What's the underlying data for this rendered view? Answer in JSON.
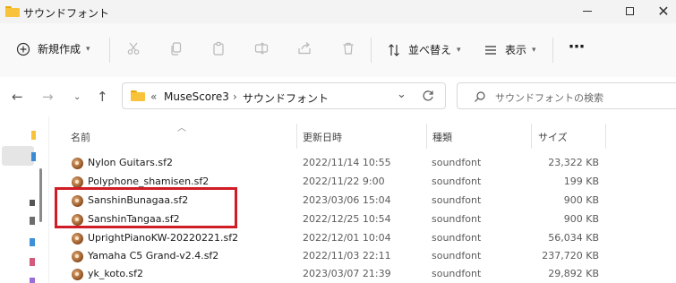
{
  "window": {
    "title": "サウンドフォント"
  },
  "commands": {
    "new_label": "新規作成",
    "sort_label": "並べ替え",
    "view_label": "表示",
    "more_label": "⋯"
  },
  "address": {
    "overflow": "«",
    "crumbs": [
      "MuseScore3",
      "サウンドフォント"
    ],
    "separator": "›"
  },
  "search": {
    "placeholder": "サウンドフォントの検索"
  },
  "columns": {
    "name": "名前",
    "modified": "更新日時",
    "type": "種類",
    "size": "サイズ"
  },
  "files": [
    {
      "name": "Nylon Guitars.sf2",
      "modified": "2022/11/14 10:55",
      "type": "soundfont",
      "size": "23,322 KB"
    },
    {
      "name": "Polyphone_shamisen.sf2",
      "modified": "2022/11/22 9:00",
      "type": "soundfont",
      "size": "199 KB"
    },
    {
      "name": "SanshinBunagaa.sf2",
      "modified": "2023/03/06 15:04",
      "type": "soundfont",
      "size": "900 KB"
    },
    {
      "name": "SanshinTangaa.sf2",
      "modified": "2022/12/25 10:54",
      "type": "soundfont",
      "size": "900 KB"
    },
    {
      "name": "UprightPianoKW-20220221.sf2",
      "modified": "2022/12/01 10:04",
      "type": "soundfont",
      "size": "56,034 KB"
    },
    {
      "name": "Yamaha C5 Grand-v2.4.sf2",
      "modified": "2022/11/03 22:11",
      "type": "soundfont",
      "size": "237,720 KB"
    },
    {
      "name": "yk_koto.sf2",
      "modified": "2023/03/07 21:39",
      "type": "soundfont",
      "size": "29,892 KB"
    }
  ],
  "colors": {
    "highlight": "#d01c25",
    "folder": "#f8c33a"
  }
}
